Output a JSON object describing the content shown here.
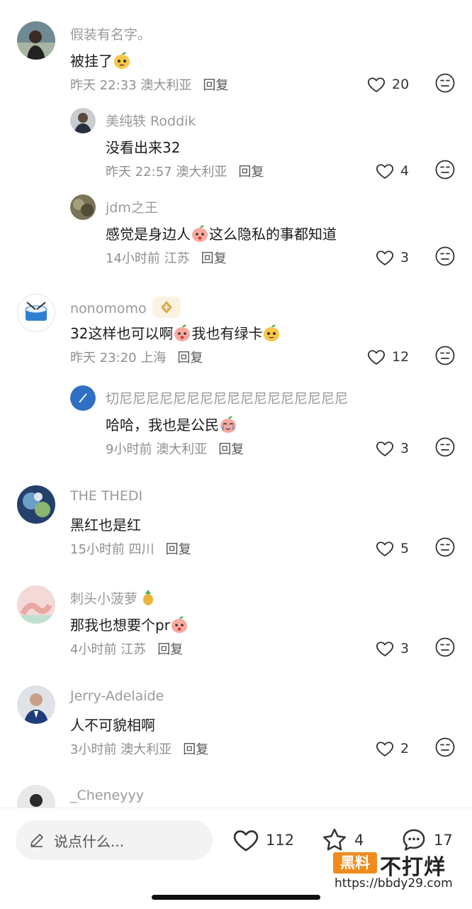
{
  "comments": [
    {
      "user": "假装有名字。",
      "text": "被挂了",
      "time": "昨天 22:33",
      "location": "澳大利亚",
      "reply": "回复",
      "likes": "20"
    },
    {
      "user": "美纯轶 Roddik",
      "text": "没看出来32",
      "time": "昨天 22:57",
      "location": "澳大利亚",
      "reply": "回复",
      "likes": "4"
    },
    {
      "user": "jdm之王",
      "text_a": "感觉是身边人",
      "text_b": "这么隐私的事都知道",
      "time": "14小时前",
      "location": "江苏",
      "reply": "回复",
      "likes": "3"
    },
    {
      "user": "nonomomo",
      "text_a": "32这样也可以啊",
      "text_b": "我也有绿卡",
      "time": "昨天 23:20",
      "location": "上海",
      "reply": "回复",
      "likes": "12"
    },
    {
      "user": "切尼尼尼尼尼尼尼尼尼尼尼尼尼尼尼尼尼",
      "text": "哈哈，我也是公民",
      "time": "9小时前",
      "location": "澳大利亚",
      "reply": "回复",
      "likes": "3"
    },
    {
      "user": "THE THEDI",
      "text": "黑红也是红",
      "time": "15小时前",
      "location": "四川",
      "reply": "回复",
      "likes": "5"
    },
    {
      "user": "刺头小菠萝",
      "text": "那我也想要个pr",
      "time": "4小时前",
      "location": "江苏",
      "reply": "回复",
      "likes": "3"
    },
    {
      "user": "Jerry-Adelaide",
      "text": "人不可貌相啊",
      "time": "3小时前",
      "location": "澳大利亚",
      "reply": "回复",
      "likes": "2"
    },
    {
      "user": "_Cheneyyy"
    }
  ],
  "bottom": {
    "placeholder": "说点什么...",
    "likes": "112",
    "favorites": "4",
    "comments": "17"
  },
  "watermark": {
    "box": "黑料",
    "title": "不打烊",
    "url": "https://bbdy29.com"
  },
  "colors": {
    "accent": "#f08a1d",
    "meta": "#8f8f8f",
    "username": "#9a9a9a"
  }
}
